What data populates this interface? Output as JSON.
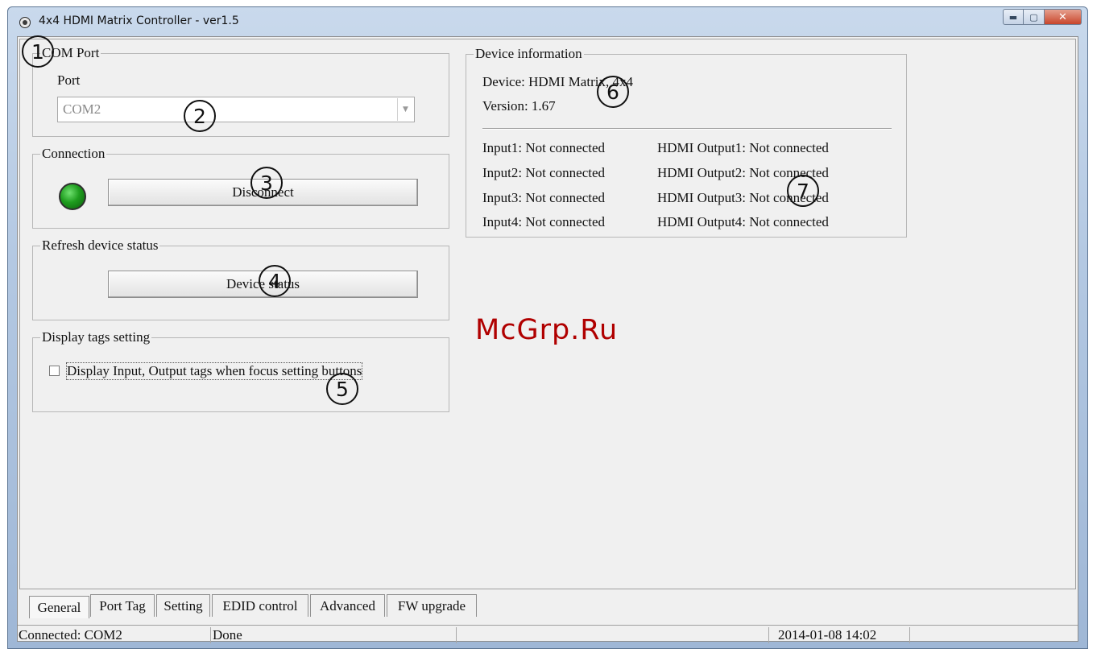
{
  "window": {
    "title": "4x4 HDMI Matrix Controller - ver1.5",
    "min_glyph": "▬",
    "max_glyph": "▢",
    "close_glyph": "✕"
  },
  "com_port": {
    "group_title": "COM Port",
    "port_label": "Port",
    "port_value": "COM2",
    "dropdown_glyph": "▼"
  },
  "connection": {
    "group_title": "Connection",
    "led_color": "#1e9d1e",
    "button_label": "Disconnect"
  },
  "refresh": {
    "group_title": "Refresh device status",
    "button_label": "Device status"
  },
  "display_tags": {
    "group_title": "Display tags setting",
    "checkbox_label": "Display Input, Output tags when focus setting buttons",
    "checked": false
  },
  "device_info": {
    "group_title": "Device information",
    "device": "Device: HDMI Matrix, 4x4",
    "version": "Version: 1.67",
    "inputs": [
      "Input1: Not connected",
      "Input2: Not connected",
      "Input3: Not connected",
      "Input4: Not connected"
    ],
    "outputs": [
      "HDMI Output1: Not connected",
      "HDMI Output2: Not connected",
      "HDMI Output3: Not connected",
      "HDMI Output4: Not connected"
    ]
  },
  "tabs": [
    "General",
    "Port Tag",
    "Setting",
    "EDID control",
    "Advanced",
    "FW upgrade"
  ],
  "active_tab": "General",
  "status": {
    "connection": "Connected: COM2",
    "state": "Done",
    "empty": "",
    "datetime": "2014-01-08 14:02"
  },
  "callouts": [
    "1",
    "2",
    "3",
    "4",
    "5",
    "6",
    "7"
  ],
  "watermark": "McGrp.Ru"
}
